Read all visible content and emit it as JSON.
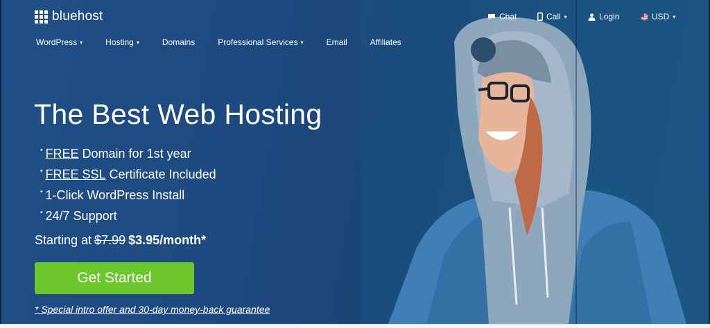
{
  "brand": {
    "name": "bluehost"
  },
  "utility_bar": {
    "chat": {
      "label": "Chat",
      "icon": "chat-icon"
    },
    "call": {
      "label": "Call",
      "icon": "phone-icon"
    },
    "login": {
      "label": "Login",
      "icon": "user-icon"
    },
    "currency": {
      "label": "USD",
      "icon": "flag-icon"
    }
  },
  "nav": {
    "items": [
      {
        "label": "WordPress",
        "has_dropdown": true
      },
      {
        "label": "Hosting",
        "has_dropdown": true
      },
      {
        "label": "Domains",
        "has_dropdown": false
      },
      {
        "label": "Professional Services",
        "has_dropdown": true
      },
      {
        "label": "Email",
        "has_dropdown": false
      },
      {
        "label": "Affiliates",
        "has_dropdown": false
      }
    ]
  },
  "hero": {
    "headline": "The Best Web Hosting",
    "features": [
      {
        "link": "FREE",
        "text": "Domain for 1st year"
      },
      {
        "link": "FREE SSL",
        "text": "Certificate Included"
      },
      {
        "link": "",
        "text": "1-Click WordPress Install"
      },
      {
        "link": "",
        "text": "24/7 Support"
      }
    ],
    "pricing": {
      "prefix": "Starting at",
      "old_price": "$7.99",
      "new_price": "$3.95/month*"
    },
    "cta_label": "Get Started",
    "disclaimer": "* Special intro offer and 30-day money-back guarantee"
  },
  "colors": {
    "hero_bg": "#1d4a7f",
    "cta": "#6cc72a",
    "text": "#ffffff"
  }
}
